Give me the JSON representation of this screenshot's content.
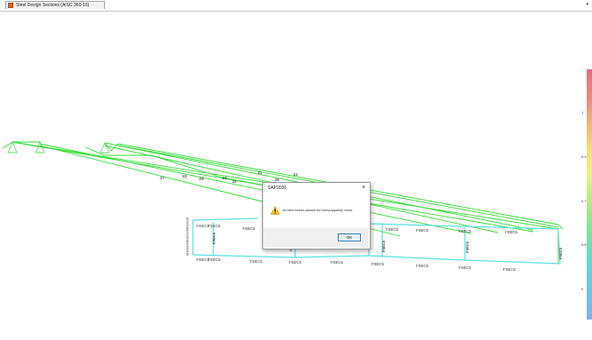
{
  "tab": {
    "title": "Steel Design Sections (AISC 360-16)",
    "menu_glyph": "▾",
    "icon": "app-icon"
  },
  "dialog": {
    "title": "SAP2000",
    "close_glyph": "×",
    "message": "All steel frames passed the stress/capacity check.",
    "ok_label": "OK",
    "icon": "warning-icon"
  },
  "frame": {
    "section_label": "FSEC5",
    "section_label_alt": "FSEC3",
    "side_label": "W12X19/W12X19/W12X26",
    "member_ids": [
      "41",
      "42",
      "36",
      "33",
      "35",
      "29",
      "28",
      "27"
    ],
    "joint_marker": "8"
  },
  "legend": {
    "ticks": [
      "1",
      "0.9",
      "0.7",
      "0.5",
      "0"
    ]
  },
  "colors": {
    "frame_line": "#33dd33",
    "section_box": "#5ee0e0",
    "support": "#66dd66",
    "legend_top": "#e9687f",
    "legend_bottom": "#7ab3ef"
  }
}
